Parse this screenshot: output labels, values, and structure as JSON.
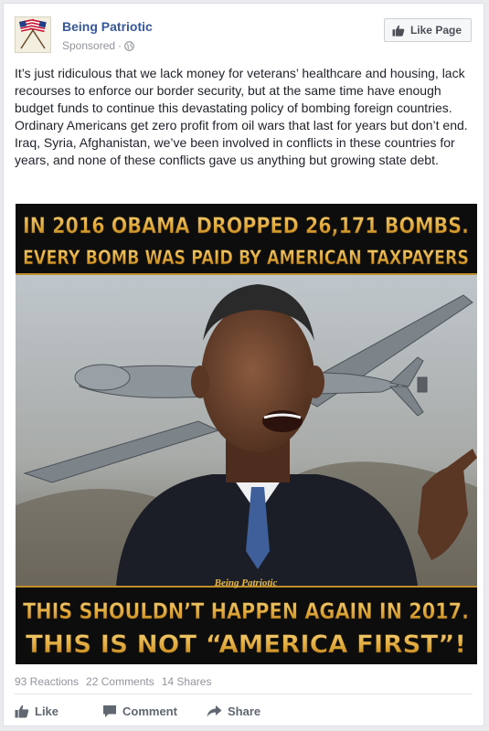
{
  "post": {
    "page_name": "Being Patriotic",
    "sponsored": "Sponsored",
    "separator": "·",
    "like_page_label": "Like Page",
    "text": "It’s just ridiculous that we lack money for veterans’ healthcare and housing, lack recourses to enforce our border security, but at the same time have enough budget funds to continue this devastating policy of bombing foreign countries. Ordinary Americans get zero profit from oil wars that last for years but don’t end. Iraq, Syria, Afghanistan, we’ve been involved in conflicts in these countries for years, and none of these conflicts gave us anything but growing state debt."
  },
  "image": {
    "headline_line1": "IN 2016 OBAMA DROPPED 26,171 BOMBS.",
    "headline_line2": "EVERY BOMB WAS PAID BY AMERICAN TAXPAYERS",
    "watermark": "Being Patriotic",
    "footer_line1": "THIS SHOULDN’T HAPPEN AGAIN IN 2017.",
    "footer_line2": "THIS IS NOT “AMERICA FIRST”!"
  },
  "stats": {
    "reactions": "93 Reactions",
    "comments": "22 Comments",
    "shares": "14 Shares"
  },
  "actions": {
    "like": "Like",
    "comment": "Comment",
    "share": "Share"
  },
  "colors": {
    "link": "#365899",
    "text": "#1d2129",
    "meta": "#90949c",
    "headline_gold": "#e7b84a"
  },
  "icons": {
    "avatar": "crossed-flags-icon",
    "privacy": "globe-icon",
    "like_page": "thumbs-up-icon",
    "comment": "speech-bubble-icon",
    "share": "share-arrow-icon"
  }
}
